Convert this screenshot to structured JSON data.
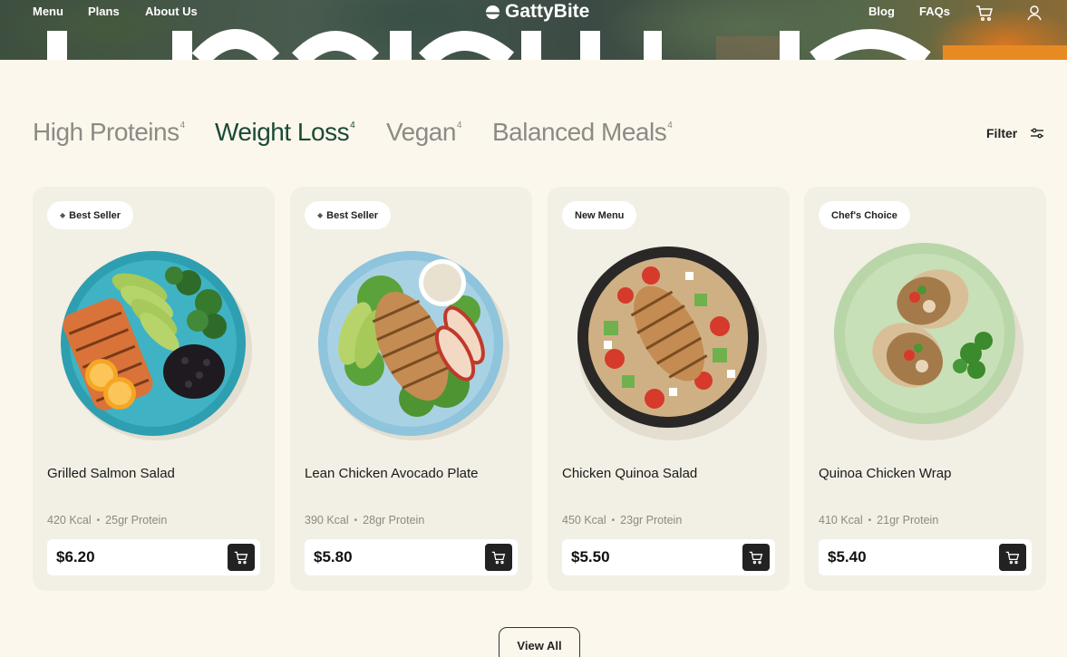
{
  "nav": {
    "left_links": [
      "Menu",
      "Plans",
      "About Us"
    ],
    "logo": "GattyBite",
    "right_links": [
      "Blog",
      "FAQs"
    ],
    "icons": [
      "cart-icon",
      "user-icon"
    ]
  },
  "categories": [
    {
      "label": "High Proteins",
      "count": "4",
      "active": false
    },
    {
      "label": "Weight Loss",
      "count": "4",
      "active": true
    },
    {
      "label": "Vegan",
      "count": "4",
      "active": false
    },
    {
      "label": "Balanced Meals",
      "count": "4",
      "active": false
    }
  ],
  "filter": {
    "label": "Filter",
    "icon": "sliders-icon"
  },
  "products": [
    {
      "badge": "Best Seller",
      "badge_icon": "diamond",
      "name": "Grilled Salmon Salad",
      "kcal": "420 Kcal",
      "protein": "25gr Protein",
      "price": "$6.20"
    },
    {
      "badge": "Best Seller",
      "badge_icon": "diamond",
      "name": "Lean Chicken Avocado Plate",
      "kcal": "390 Kcal",
      "protein": "28gr Protein",
      "price": "$5.80"
    },
    {
      "badge": "New Menu",
      "badge_icon": "",
      "name": "Chicken Quinoa Salad",
      "kcal": "450 Kcal",
      "protein": "23gr Protein",
      "price": "$5.50"
    },
    {
      "badge": "Chef's Choice",
      "badge_icon": "",
      "name": "Quinoa Chicken Wrap",
      "kcal": "410 Kcal",
      "protein": "21gr Protein",
      "price": "$5.40"
    }
  ],
  "view_all": "View All",
  "colors": {
    "background": "#fbf7ec",
    "card": "#f2efe5",
    "active_tab": "#1b4a36",
    "inactive_tab": "#8b8b86",
    "cart_button": "#222222"
  }
}
